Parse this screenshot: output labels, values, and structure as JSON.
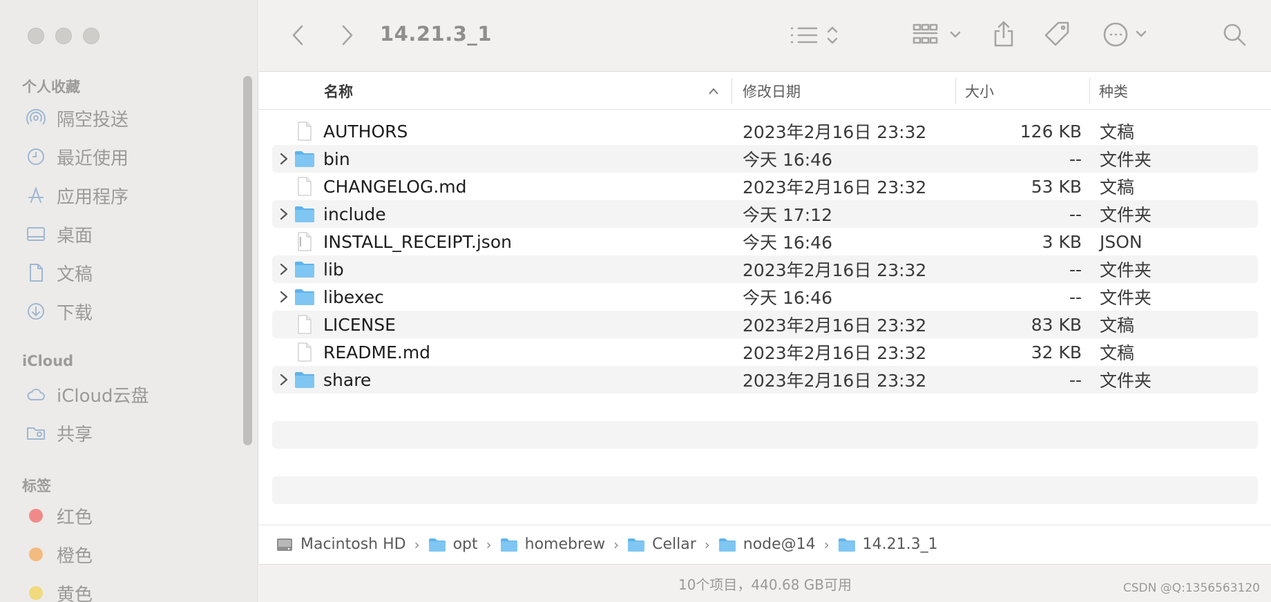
{
  "window": {
    "title": "14.21.3_1"
  },
  "sidebar": {
    "favorites_title": "个人收藏",
    "favorites": [
      {
        "label": "隔空投送",
        "icon": "airdrop-icon"
      },
      {
        "label": "最近使用",
        "icon": "clock-icon"
      },
      {
        "label": "应用程序",
        "icon": "applications-icon"
      },
      {
        "label": "桌面",
        "icon": "desktop-icon"
      },
      {
        "label": "文稿",
        "icon": "document-icon"
      },
      {
        "label": "下载",
        "icon": "download-icon"
      }
    ],
    "icloud_title": "iCloud",
    "icloud": [
      {
        "label": "iCloud云盘",
        "icon": "cloud-icon"
      },
      {
        "label": "共享",
        "icon": "shared-folder-icon"
      }
    ],
    "tags_title": "标签",
    "tags": [
      {
        "label": "红色",
        "color": "#f08a8a"
      },
      {
        "label": "橙色",
        "color": "#f2bb80"
      },
      {
        "label": "黄色",
        "color": "#f1da7e"
      }
    ]
  },
  "columns": {
    "name": "名称",
    "date": "修改日期",
    "size": "大小",
    "kind": "种类"
  },
  "files": [
    {
      "name": "AUTHORS",
      "date": "2023年2月16日 23:32",
      "size": "126 KB",
      "kind": "文稿",
      "type": "file"
    },
    {
      "name": "bin",
      "date": "今天 16:46",
      "size": "--",
      "kind": "文件夹",
      "type": "folder"
    },
    {
      "name": "CHANGELOG.md",
      "date": "2023年2月16日 23:32",
      "size": "53 KB",
      "kind": "文稿",
      "type": "file"
    },
    {
      "name": "include",
      "date": "今天 17:12",
      "size": "--",
      "kind": "文件夹",
      "type": "folder"
    },
    {
      "name": "INSTALL_RECEIPT.json",
      "date": "今天 16:46",
      "size": "3 KB",
      "kind": "JSON",
      "type": "json"
    },
    {
      "name": "lib",
      "date": "2023年2月16日 23:32",
      "size": "--",
      "kind": "文件夹",
      "type": "folder"
    },
    {
      "name": "libexec",
      "date": "今天 16:46",
      "size": "--",
      "kind": "文件夹",
      "type": "folder"
    },
    {
      "name": "LICENSE",
      "date": "2023年2月16日 23:32",
      "size": "83 KB",
      "kind": "文稿",
      "type": "file"
    },
    {
      "name": "README.md",
      "date": "2023年2月16日 23:32",
      "size": "32 KB",
      "kind": "文稿",
      "type": "file"
    },
    {
      "name": "share",
      "date": "2023年2月16日 23:32",
      "size": "--",
      "kind": "文件夹",
      "type": "folder"
    }
  ],
  "path": [
    {
      "label": "Macintosh HD",
      "icon": "hard-drive-icon"
    },
    {
      "label": "opt",
      "icon": "folder-icon"
    },
    {
      "label": "homebrew",
      "icon": "folder-icon"
    },
    {
      "label": "Cellar",
      "icon": "folder-icon"
    },
    {
      "label": "node@14",
      "icon": "folder-icon"
    },
    {
      "label": "14.21.3_1",
      "icon": "folder-icon"
    }
  ],
  "status": "10个项目，440.68 GB可用",
  "watermark": "CSDN @Q:1356563120",
  "colors": {
    "folder": "#5eb3ec",
    "folder_top": "#7fc6f2",
    "row_alt": "#f4f4f4"
  }
}
